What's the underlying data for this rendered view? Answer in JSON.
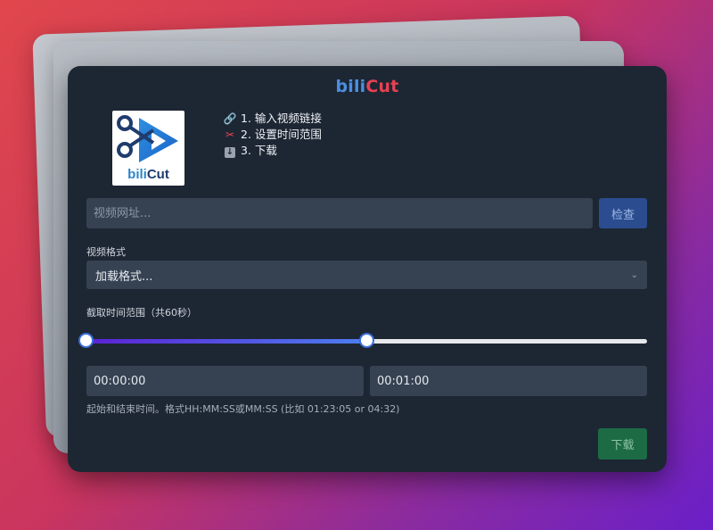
{
  "app": {
    "title_part1": "bili",
    "title_part2": "Cut",
    "logo_text_part1": "bili",
    "logo_text_part2": "Cut"
  },
  "steps": [
    {
      "icon": "link-icon",
      "label": "1. 输入视频链接"
    },
    {
      "icon": "scissors-icon",
      "label": "2. 设置时间范围"
    },
    {
      "icon": "download-icon",
      "label": "3. 下载"
    }
  ],
  "url": {
    "placeholder": "视频网址...",
    "check_label": "检查"
  },
  "format": {
    "label": "视频格式",
    "selected": "加载格式..."
  },
  "range": {
    "label": "截取时间范围（共60秒）",
    "start_fraction": 0.0,
    "end_fraction": 0.5,
    "start_value": "00:00:00",
    "end_value": "00:01:00",
    "hint": "起始和结束时间。格式HH:MM:SS或MM:SS (比如 01:23:05 or 04:32)"
  },
  "download": {
    "label": "下载"
  },
  "colors": {
    "accent_blue": "#4a90e2",
    "accent_red": "#e84152",
    "check_button": "#2b4d8f",
    "download_button": "#1d6b45",
    "card_bg": "#1d2633"
  }
}
